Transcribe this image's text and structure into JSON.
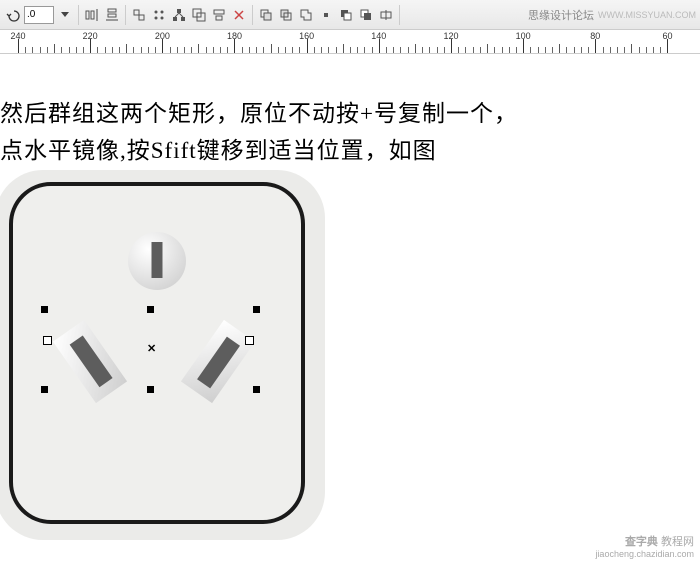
{
  "toolbar": {
    "undo_value": ".0",
    "forum_name": "思缘设计论坛",
    "forum_url": "WWW.MISSYUAN.COM"
  },
  "ruler": {
    "ticks": [
      240,
      220,
      200,
      180,
      160,
      140,
      120,
      100,
      80,
      60
    ]
  },
  "instruction": {
    "line1": "然后群组这两个矩形，原位不动按+号复制一个，",
    "line2": "点水平镜像,按Sfift键移到适当位置，如图"
  },
  "watermark": {
    "brand": "查字典",
    "sub_brand": "教程网",
    "url": "jiaocheng.chazidian.com"
  }
}
